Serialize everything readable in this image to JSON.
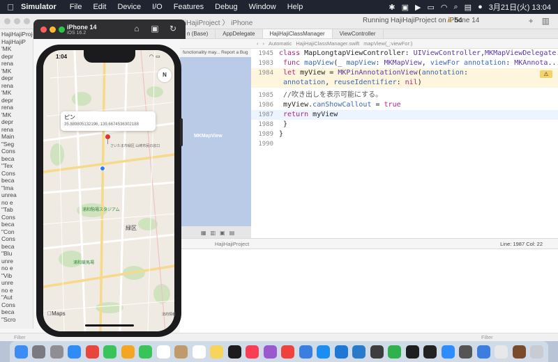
{
  "menubar": {
    "app_name": "Simulator",
    "items": [
      "File",
      "Edit",
      "Device",
      "I/O",
      "Features",
      "Debug",
      "Window",
      "Help"
    ],
    "datetime": "3月21日(火) 13:04"
  },
  "xcode": {
    "project_title": "HajiHajiProject 〉 iPhone",
    "run_status": "Running HajiHajiProject on iPhone 14",
    "warning_count": "54",
    "tabs": [
      "n (Base)",
      "AppDelegate",
      "HajiHajiClassManager",
      "ViewController"
    ],
    "jumpbar": [
      "Automatic",
      "HajiHajiClassManager.swift",
      "mapView(_:viewFor:)"
    ],
    "canvas_label": "MKMapView",
    "hint_strip": "functionality may... Report a Bug",
    "code_lines": [
      {
        "num": "1945",
        "text": "class MapLongtapViewController: UIViewController,MKMapViewDelegate..."
      },
      {
        "num": "1983",
        "text": "    func mapView(_ mapView: MKMapView, viewFor annotation: MKAnnota..."
      },
      {
        "num": "1984",
        "text": "        let myView = MKPinAnnotationView(annotation:"
      },
      {
        "num": "",
        "text": "            annotation, reuseIdentifier: nil)"
      },
      {
        "num": "1985",
        "text": "        //吹き出しを表示可能にする。"
      },
      {
        "num": "1986",
        "text": "        myView.canShowCallout = true"
      },
      {
        "num": "1987",
        "text": "        return myView"
      },
      {
        "num": "1988",
        "text": "    }"
      },
      {
        "num": "1989",
        "text": "}"
      },
      {
        "num": "1990",
        "text": ""
      }
    ],
    "debug_project": "HajiHajiProject",
    "cursor_pos": "Line: 1987  Col: 22",
    "filter_left": "Filter",
    "filter_right": "Filter",
    "navigator": [
      "HajiHajiProje",
      "HajiHajiP",
      "'MK",
      "depr",
      "rena",
      "'MK",
      "depr",
      "rena",
      "'MK",
      "depr",
      "rena",
      "'MK",
      "depr",
      "rena",
      "Main",
      "\"Seg",
      "Cons",
      "beca",
      "\"Tex",
      "Cons",
      "beca",
      "\"Ima",
      "unrea",
      "no e",
      "\"Tab",
      "Cons",
      "beca",
      "\"Con",
      "Cons",
      "beca",
      "\"Blu",
      "unre",
      "no e",
      "\"Vib",
      "unre",
      "no e",
      "\"Aut",
      "Cons",
      "beca",
      "\"Scro"
    ]
  },
  "simulator": {
    "device_name": "iPhone 14",
    "ios_version": "iOS 16.2",
    "status_time": "1:04",
    "compass": "N",
    "callout_title": "ピン",
    "callout_subtitle": "35.889805132196, 139.6674536302188",
    "pin_label": "さいたま市緑区 山崎市民の窓口",
    "park1": "浦和駒場スタジアム",
    "ward": "緑区",
    "park2": "浦和競馬場",
    "maps_logo": "Maps",
    "legal": "法的情報"
  },
  "colors": {
    "menubar_bg": "#1f2430",
    "keyword": "#b4227f",
    "type": "#5b34a6",
    "function": "#3a66b4",
    "pin": "#e5332a",
    "user_location": "#2f7bf5"
  },
  "dock": [
    "finder",
    "launchpad",
    "system-prefs",
    "safari",
    "chrome",
    "messages",
    "photos",
    "facetime",
    "calendar",
    "contacts",
    "reminders",
    "notes",
    "tv",
    "music",
    "podcasts",
    "news",
    "keynote",
    "app-store",
    "xcode",
    "vscode",
    "instruments",
    "numbers",
    "figma",
    "terminal",
    "zoom",
    "calculator",
    "simulator",
    "preview",
    "dictionary",
    "trash"
  ]
}
